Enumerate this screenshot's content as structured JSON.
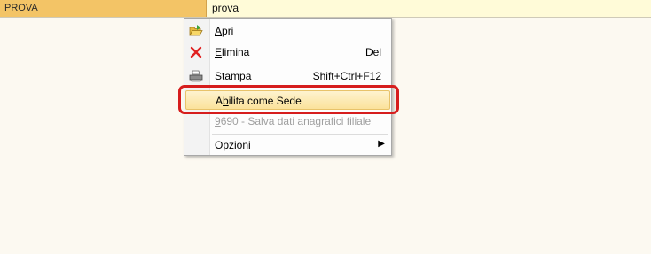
{
  "grid": {
    "row": {
      "code": "PROVA",
      "description": "prova"
    }
  },
  "context_menu": {
    "items": [
      {
        "key": "apri",
        "mnemonic": "A",
        "rest": "pri",
        "shortcut": "",
        "icon": "folder-open-icon",
        "disabled": false
      },
      {
        "key": "elimina",
        "mnemonic": "E",
        "rest": "limina",
        "shortcut": "Del",
        "icon": "delete-x-icon",
        "disabled": false
      },
      {
        "key": "stampa",
        "mnemonic": "S",
        "rest": "tampa",
        "shortcut": "Shift+Ctrl+F12",
        "icon": "printer-icon",
        "disabled": false
      },
      {
        "key": "abilita",
        "pre": "A",
        "mnemonic": "b",
        "rest": "ilita come Sede",
        "shortcut": "",
        "icon": "",
        "disabled": false,
        "hovered": true
      },
      {
        "key": "salva",
        "mnemonic": "9",
        "rest": "690 - Salva dati anagrafici filiale",
        "shortcut": "",
        "icon": "",
        "disabled": true
      },
      {
        "key": "opzioni",
        "mnemonic": "O",
        "rest": "pzioni",
        "shortcut": "",
        "icon": "",
        "submenu": true,
        "disabled": false
      }
    ]
  },
  "colors": {
    "selected_cell": "#f3c466",
    "row_background": "#fffbd8",
    "hover_item": "#fbe29b",
    "annotation_ring": "#d61d1d"
  }
}
